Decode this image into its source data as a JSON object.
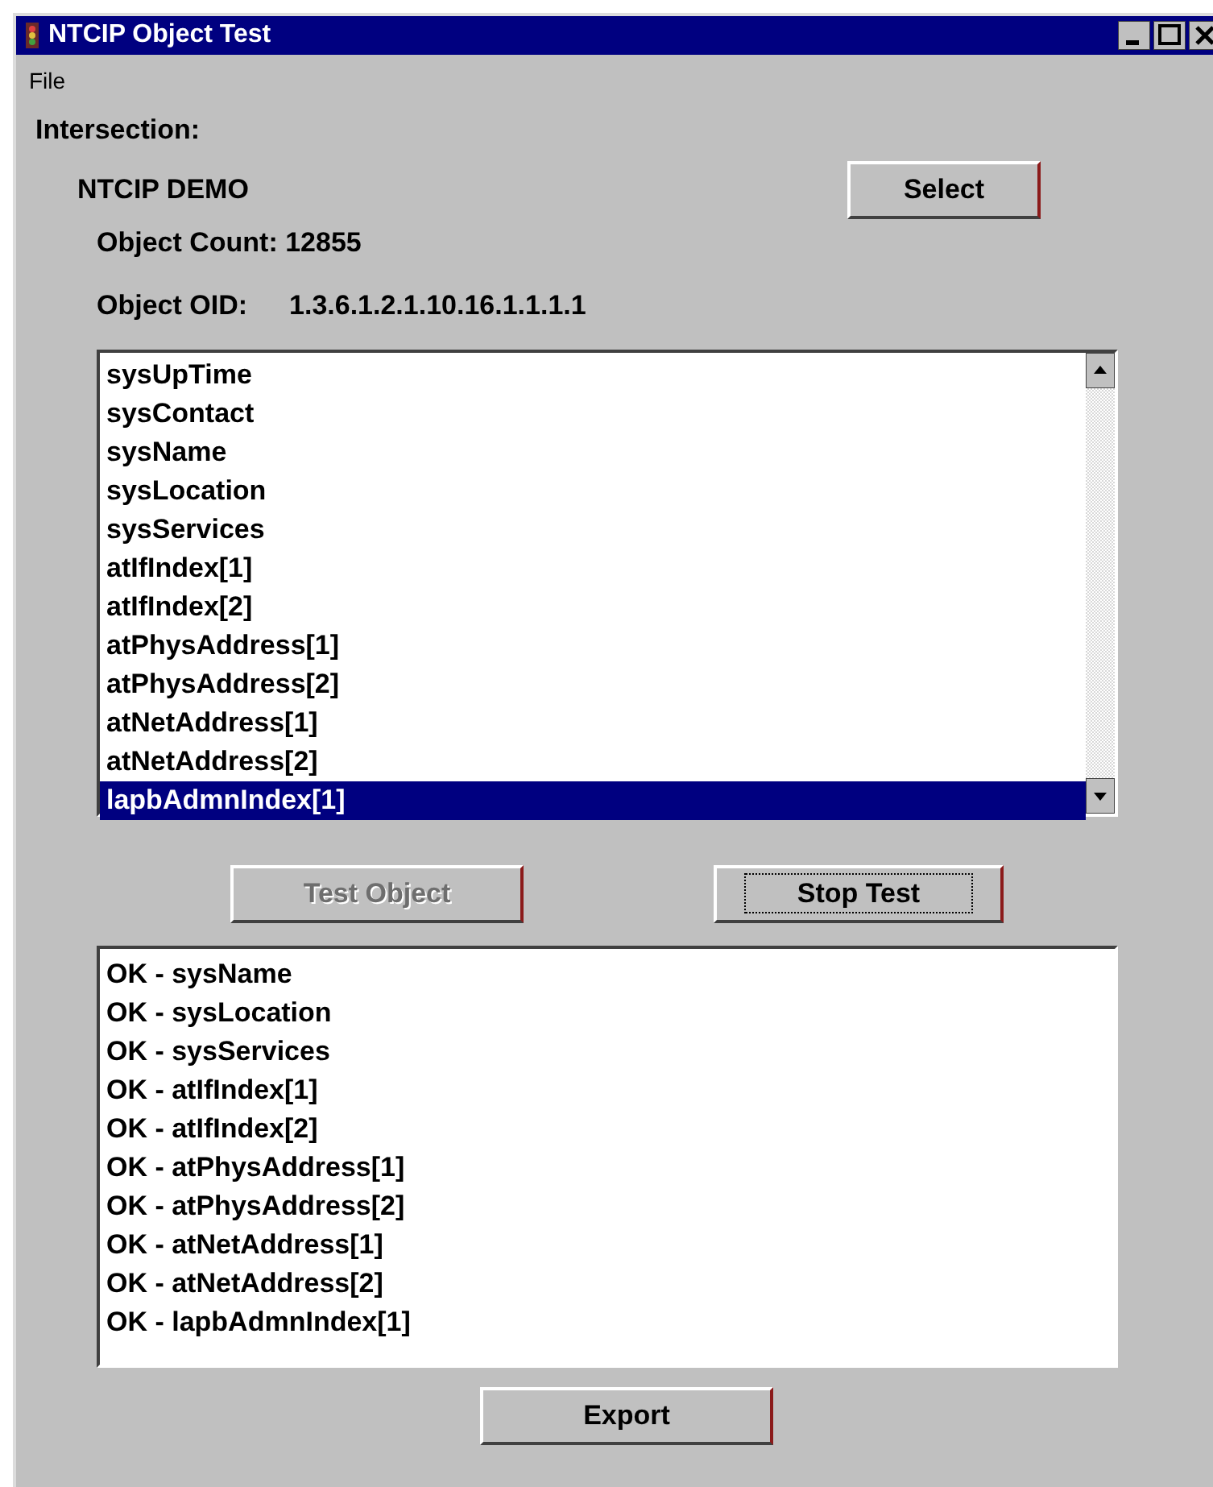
{
  "window": {
    "title": "NTCIP Object Test"
  },
  "menu": [
    {
      "label": "File"
    }
  ],
  "intersection_label": "Intersection:",
  "intersection_name": "NTCIP DEMO",
  "select_button": {
    "label": "Select"
  },
  "object_count": "Object Count: 12855",
  "object_oid": {
    "label": "Object OID:",
    "value": "1.3.6.1.2.1.10.16.1.1.1.1"
  },
  "objects": [
    {
      "label": "sysUpTime",
      "selected": false
    },
    {
      "label": "sysContact",
      "selected": false
    },
    {
      "label": "sysName",
      "selected": false
    },
    {
      "label": "sysLocation",
      "selected": false
    },
    {
      "label": "sysServices",
      "selected": false
    },
    {
      "label": "atIfIndex[1]",
      "selected": false
    },
    {
      "label": "atIfIndex[2]",
      "selected": false
    },
    {
      "label": "atPhysAddress[1]",
      "selected": false
    },
    {
      "label": "atPhysAddress[2]",
      "selected": false
    },
    {
      "label": "atNetAddress[1]",
      "selected": false
    },
    {
      "label": "atNetAddress[2]",
      "selected": false
    },
    {
      "label": "lapbAdmnIndex[1]",
      "selected": true
    }
  ],
  "actions": [
    {
      "label": "Test Object",
      "disabled": true,
      "focused": false
    },
    {
      "label": "Stop Test",
      "disabled": false,
      "focused": true
    }
  ],
  "results": [
    "OK - sysName",
    "OK - sysLocation",
    "OK - sysServices",
    "OK - atIfIndex[1]",
    "OK - atIfIndex[2]",
    "OK - atPhysAddress[1]",
    "OK - atPhysAddress[2]",
    "OK - atNetAddress[1]",
    "OK - atNetAddress[2]",
    "OK - lapbAdmnIndex[1]"
  ],
  "export_button": {
    "label": "Export"
  }
}
